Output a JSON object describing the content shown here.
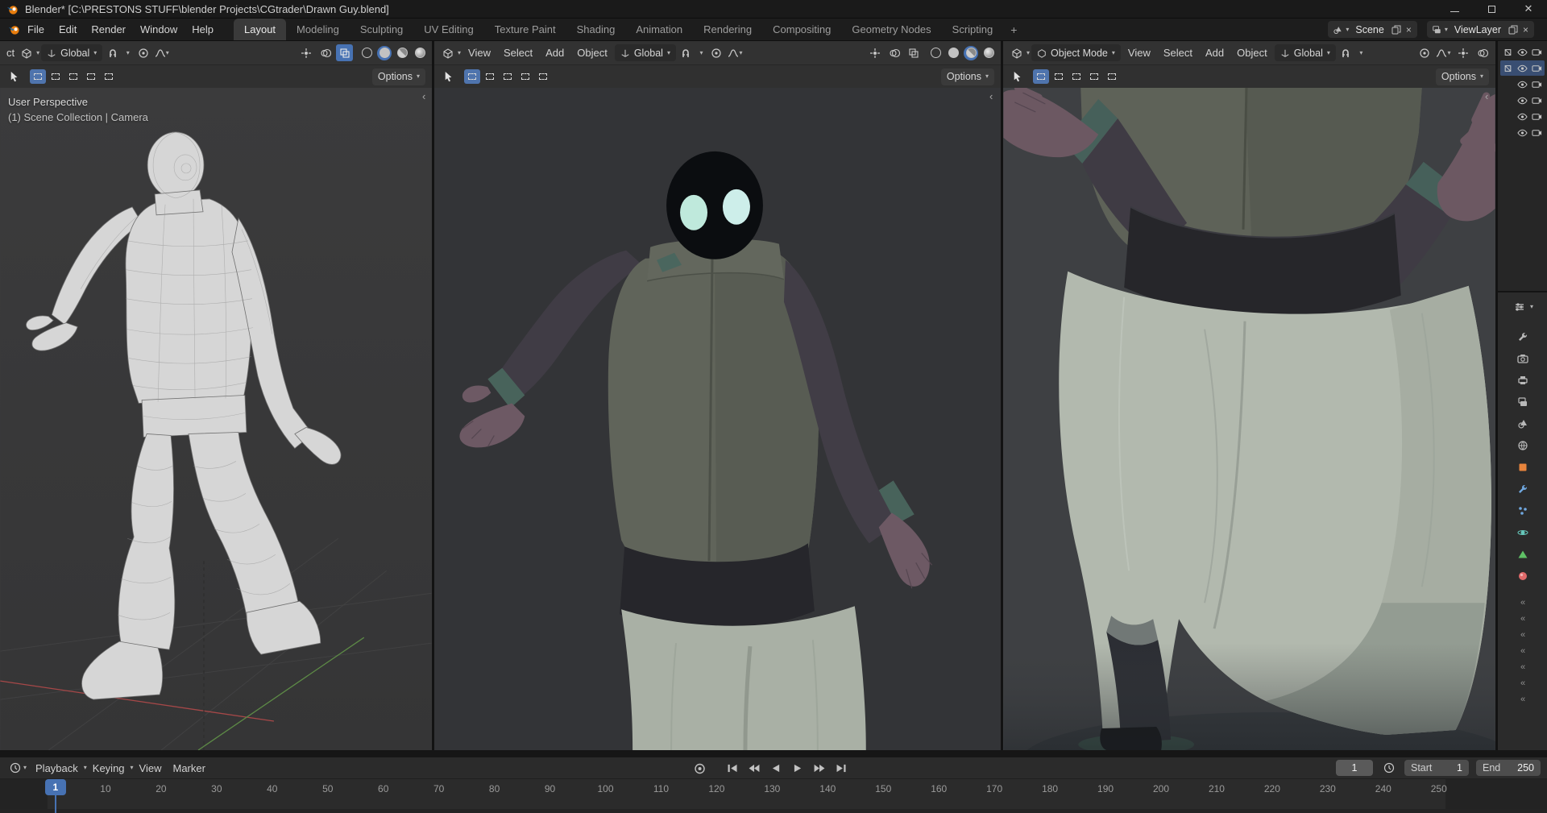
{
  "window": {
    "title": "Blender* [C:\\PRESTONS STUFF\\blender Projects\\CGtrader\\Drawn Guy.blend]"
  },
  "topbar": {
    "menus": [
      "File",
      "Edit",
      "Render",
      "Window",
      "Help"
    ],
    "tabs": [
      "Layout",
      "Modeling",
      "Sculpting",
      "UV Editing",
      "Texture Paint",
      "Shading",
      "Animation",
      "Rendering",
      "Compositing",
      "Geometry Nodes",
      "Scripting"
    ],
    "active_tab": "Layout",
    "add_tab": "+",
    "scene": {
      "label": "Scene"
    },
    "viewlayer": {
      "label": "ViewLayer"
    }
  },
  "viewports": {
    "left": {
      "mode_fragment": "ct",
      "orientation": "Global",
      "options": "Options",
      "overlay": {
        "line1": "User Perspective",
        "line2": "(1) Scene Collection | Camera"
      },
      "active_shading": "solid"
    },
    "center": {
      "menus": [
        "View",
        "Select",
        "Add",
        "Object"
      ],
      "orientation": "Global",
      "options": "Options",
      "active_shading": "material-preview"
    },
    "right": {
      "mode": "Object Mode",
      "menus": [
        "View",
        "Select",
        "Add",
        "Object"
      ],
      "orientation": "Global",
      "options": "Options",
      "active_shading": "material-preview"
    },
    "select_modes": [
      "set",
      "extend",
      "subtract",
      "invert",
      "intersect"
    ],
    "shading_modes": [
      "wireframe",
      "solid",
      "material-preview",
      "rendered"
    ]
  },
  "outliner": {
    "rows": [
      {
        "mesh_icon": true,
        "selected": false
      },
      {
        "mesh_icon": true,
        "selected": true
      },
      {
        "mesh_icon": false,
        "selected": false
      },
      {
        "mesh_icon": false,
        "selected": false
      },
      {
        "mesh_icon": false,
        "selected": false
      },
      {
        "mesh_icon": false,
        "selected": false
      }
    ]
  },
  "properties": {
    "tabs": [
      {
        "name": "active-tool",
        "shape": "wrench",
        "color": "#b8b8b8"
      },
      {
        "name": "render",
        "shape": "camera",
        "color": "#b8b8b8"
      },
      {
        "name": "output",
        "shape": "printer",
        "color": "#b8b8b8"
      },
      {
        "name": "view-layer",
        "shape": "layers",
        "color": "#b8b8b8"
      },
      {
        "name": "scene",
        "shape": "scene",
        "color": "#b8b8b8"
      },
      {
        "name": "world",
        "shape": "world",
        "color": "#b8b8b8"
      },
      {
        "name": "object",
        "shape": "square",
        "color": "#e8843c"
      },
      {
        "name": "modifiers",
        "shape": "wrench",
        "color": "#70a8e0"
      },
      {
        "name": "particles",
        "shape": "dots",
        "color": "#70a8e0"
      },
      {
        "name": "physics",
        "shape": "orbit",
        "color": "#66c8bc"
      },
      {
        "name": "object-data",
        "shape": "triangle",
        "color": "#5fc065"
      },
      {
        "name": "material",
        "shape": "sphere",
        "color": "#e06a6a"
      }
    ],
    "collapsed_chevron_count": 7
  },
  "timeline": {
    "menus": [
      "Playback",
      "Keying",
      "View",
      "Marker"
    ],
    "transport": [
      "jump-to-start",
      "jump-to-prev-keyframe",
      "play-reverse",
      "play",
      "jump-to-next-keyframe",
      "jump-to-end"
    ],
    "current_frame": "1",
    "start_label": "Start",
    "start_value": "1",
    "end_label": "End",
    "end_value": "250",
    "ruler_labels": [
      "1",
      "10",
      "20",
      "30",
      "40",
      "50",
      "60",
      "70",
      "80",
      "90",
      "100",
      "110",
      "120",
      "130",
      "140",
      "150",
      "160",
      "170",
      "180",
      "190",
      "200",
      "210",
      "220",
      "230",
      "240",
      "250"
    ],
    "playhead_frame": 1
  },
  "colors": {
    "accent_blue": "#4772b3",
    "topbar_bg": "#1d1d1d",
    "header_bg": "#323232",
    "viewport_bg_left": "#3a3a3b",
    "viewport_bg_center": "#333437",
    "viewport_bg_right": "#3e4043",
    "timeline_bg": "#2b2b2b",
    "helmet": "#0b0d10",
    "eyes": "#c7ebe0",
    "vest": "#60645a",
    "sleeves": "#413d46",
    "gloves": "#6d5964",
    "cuffs": "#48635b",
    "waistband": "#26262b",
    "pants": "#aeb5aa"
  }
}
